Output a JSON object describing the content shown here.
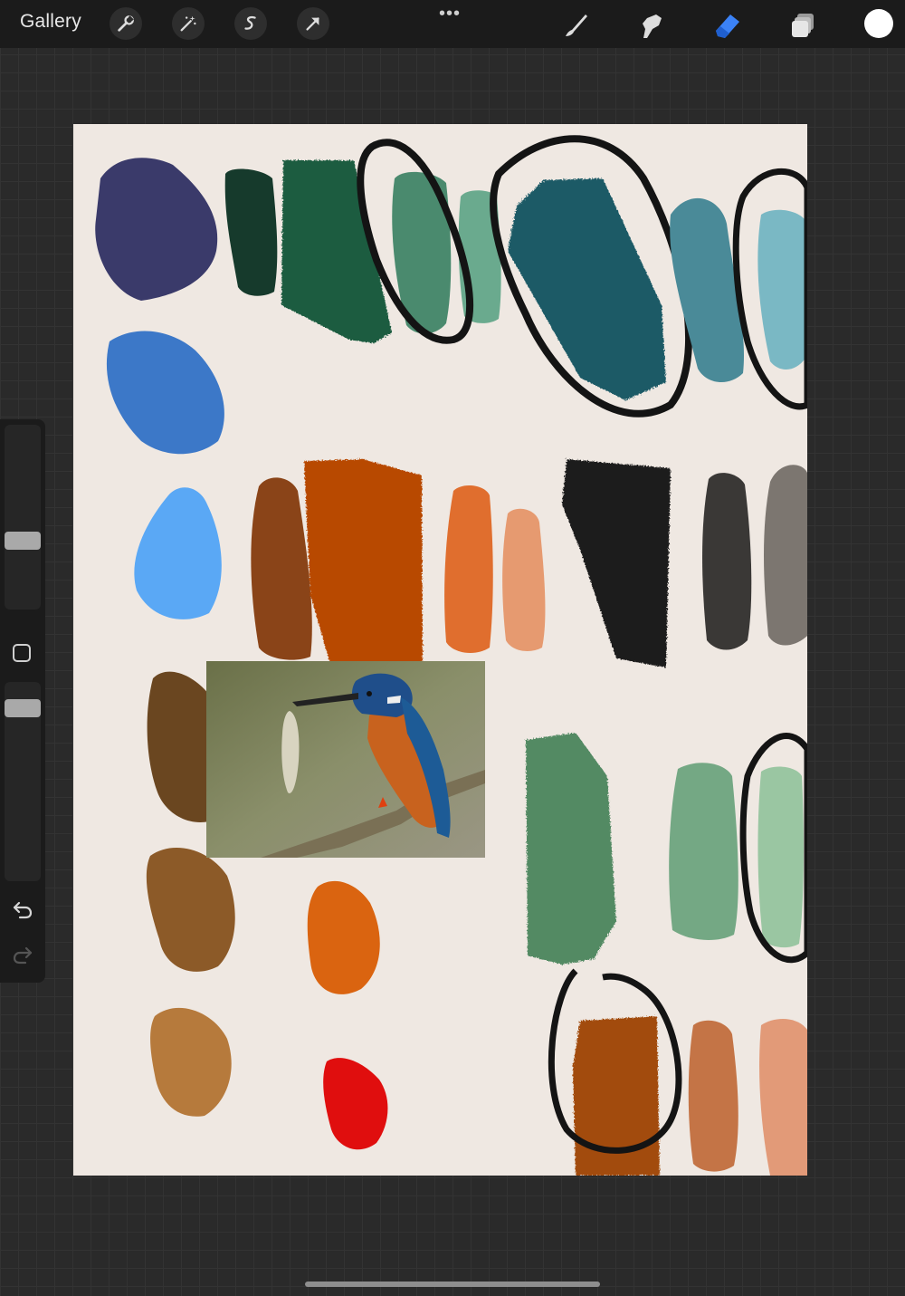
{
  "topbar": {
    "gallery_label": "Gallery",
    "more_label": "•••",
    "left_tools": [
      "wrench-icon",
      "magic-wand-icon",
      "selection-icon",
      "transform-arrow-icon"
    ],
    "right_tools": [
      "brush-icon",
      "smudge-icon",
      "eraser-icon",
      "layers-icon"
    ],
    "active_tool": "eraser-icon",
    "active_color": "#ffffff",
    "active_tool_color": "#3b82f6"
  },
  "sidebar": {
    "brush_size_level": 0.59,
    "opacity_level": 0.76,
    "controls": [
      "modifier-button",
      "undo-icon",
      "redo-icon"
    ]
  },
  "canvas": {
    "background_color": "#efe8e2",
    "swatch_colors": {
      "navy": "#3a3a6a",
      "dark_green": "#163a2c",
      "forest_green": "#1a5c40",
      "sage_green": "#4a8a6e",
      "light_sage": "#6aaa8e",
      "deep_teal": "#1b5a66",
      "teal": "#4a8a98",
      "light_teal": "#7ab8c4",
      "royal_blue": "#3c78c8",
      "sky_blue": "#5aa8f5",
      "brown": "#8a4418",
      "rust": "#b84800",
      "orange": "#e06e2e",
      "peach": "#e69a70",
      "near_black": "#1e1e1e",
      "charcoal": "#3a3836",
      "gray": "#7c7670",
      "umber": "#6a4620",
      "ochre": "#8c5a28",
      "tan": "#b67a3c",
      "bright_orange": "#da6410",
      "red": "#e00e0e",
      "medium_green": "#528a64",
      "pale_green": "#74a884",
      "mint": "#9ac6a2",
      "burnt_orange": "#a24c0a",
      "terracotta": "#c47446",
      "salmon": "#e29a78",
      "outline": "#141414"
    },
    "reference_image": "kingfisher-with-fish-photo"
  }
}
